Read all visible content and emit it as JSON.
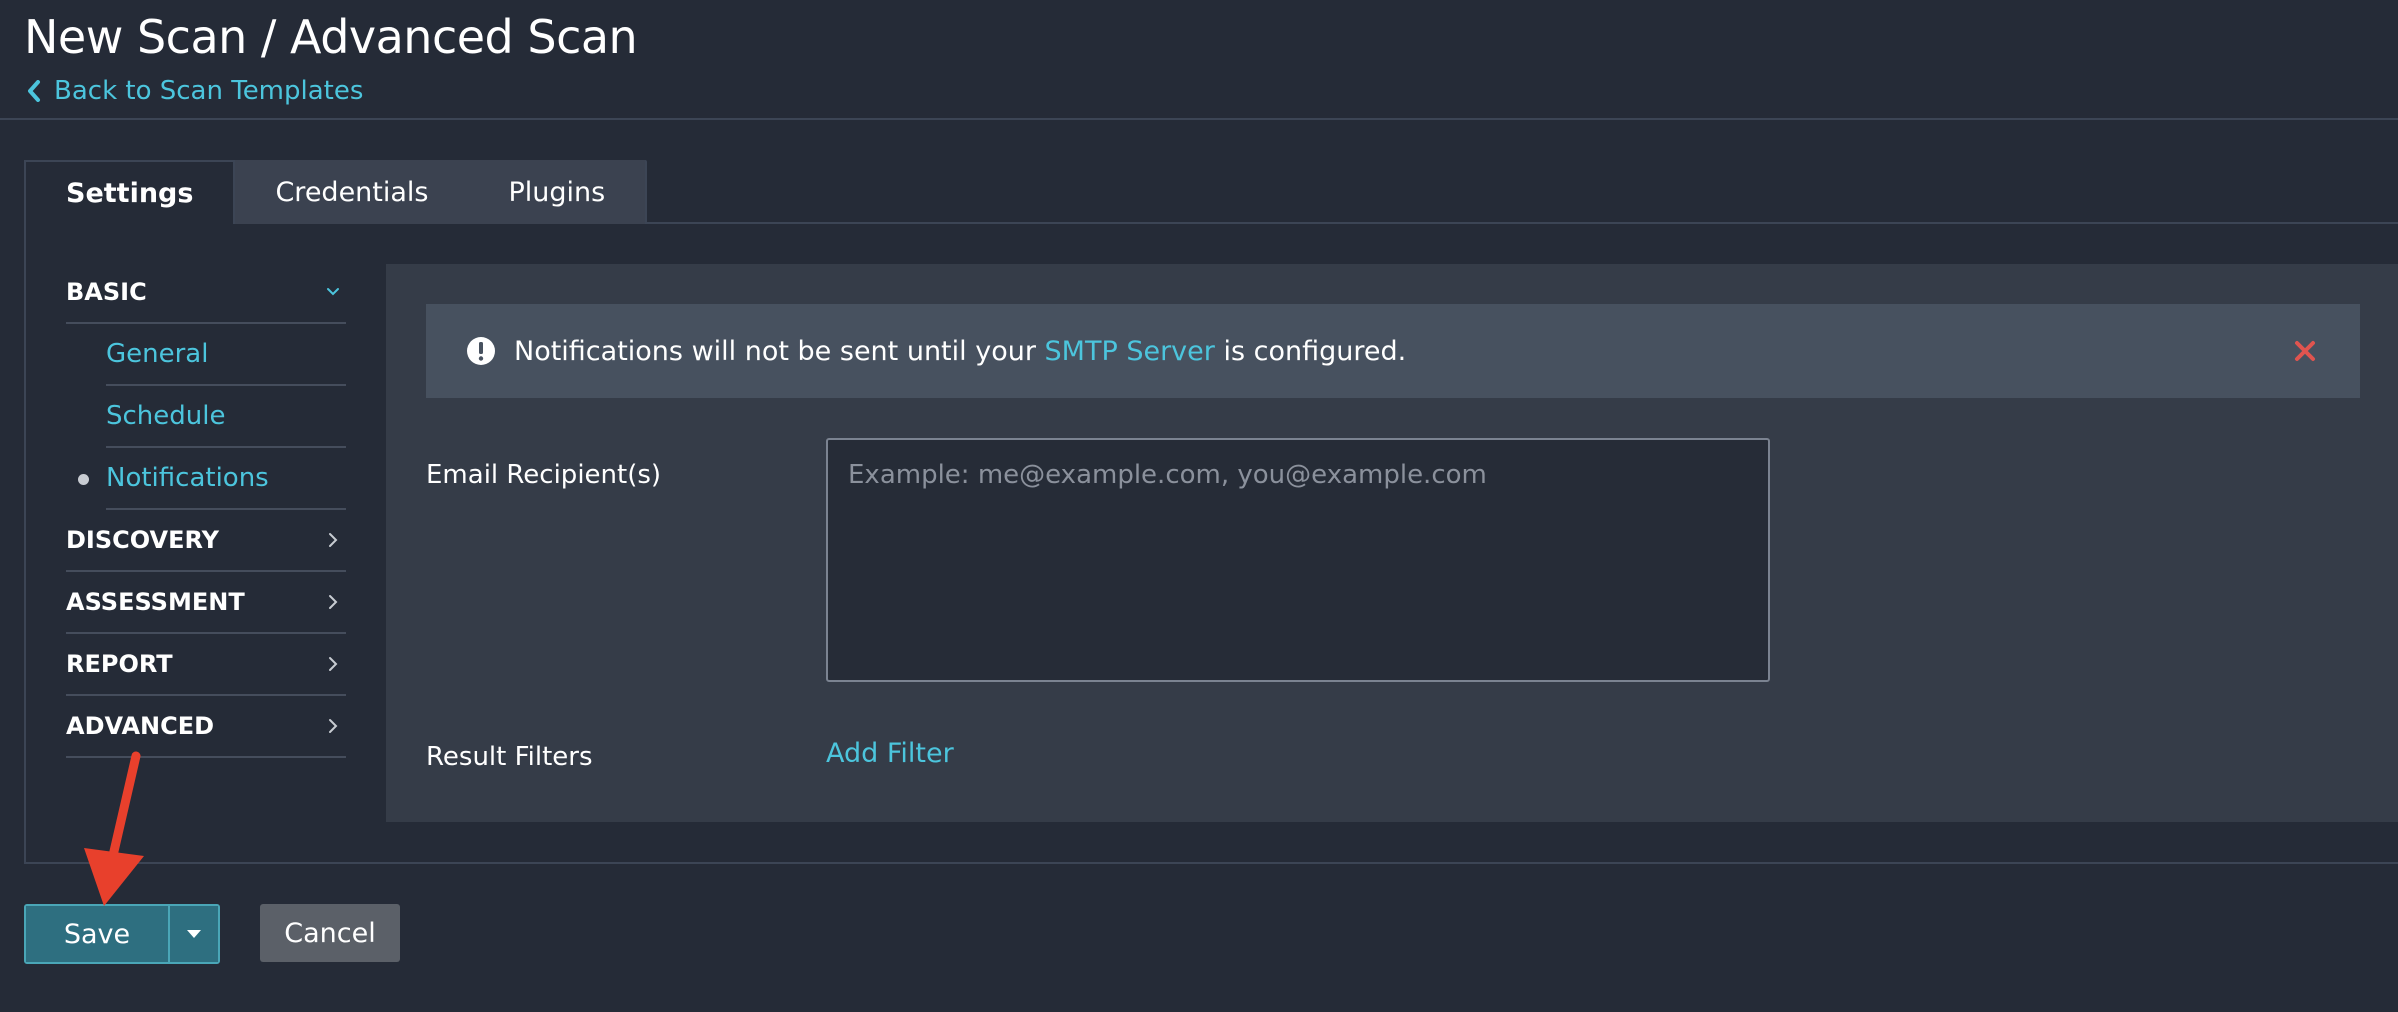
{
  "header": {
    "title": "New Scan / Advanced Scan",
    "back_link": "Back to Scan Templates"
  },
  "tabs": [
    {
      "label": "Settings",
      "active": true
    },
    {
      "label": "Credentials",
      "active": false
    },
    {
      "label": "Plugins",
      "active": false
    }
  ],
  "sidebar": {
    "sections": [
      {
        "label": "BASIC",
        "expanded": true,
        "items": [
          {
            "label": "General"
          },
          {
            "label": "Schedule"
          },
          {
            "label": "Notifications",
            "selected": true
          }
        ]
      },
      {
        "label": "DISCOVERY",
        "expanded": false
      },
      {
        "label": "ASSESSMENT",
        "expanded": false
      },
      {
        "label": "REPORT",
        "expanded": false
      },
      {
        "label": "ADVANCED",
        "expanded": false
      }
    ]
  },
  "alert": {
    "text_before": "Notifications will not be sent until your ",
    "link": "SMTP Server",
    "text_after": " is configured."
  },
  "form": {
    "email_label": "Email Recipient(s)",
    "email_placeholder": "Example: me@example.com, you@example.com",
    "email_value": "",
    "result_filters_label": "Result Filters",
    "add_filter_label": "Add Filter"
  },
  "actions": {
    "save_label": "Save",
    "cancel_label": "Cancel"
  },
  "colors": {
    "background": "#252b37",
    "panel": "#353c48",
    "accent": "#4cc5dd",
    "save_button": "#2e6f80",
    "close_icon": "#e0544f",
    "annotation_arrow": "#e8402c"
  }
}
